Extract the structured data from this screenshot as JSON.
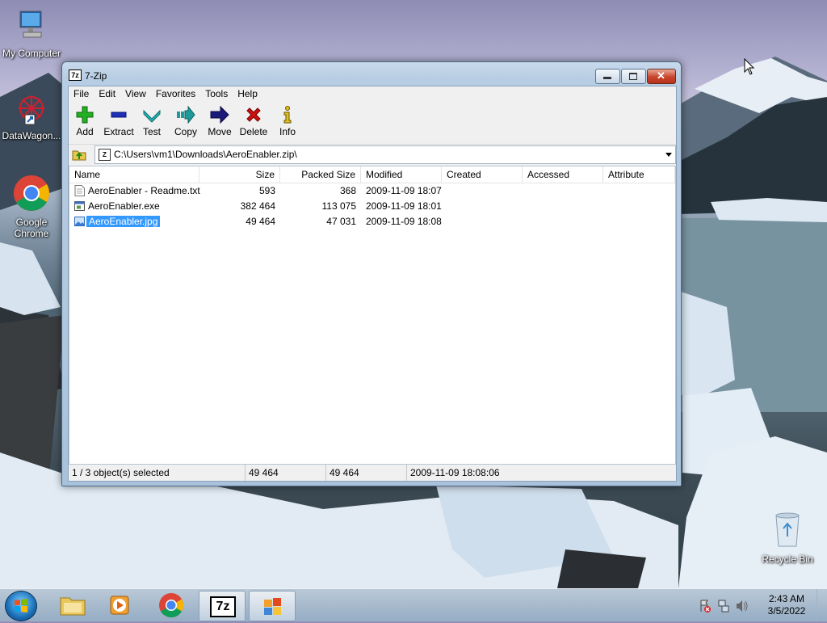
{
  "desktop": {
    "icons": [
      {
        "label": "My Computer"
      },
      {
        "label": "DataWagon..."
      },
      {
        "label_line1": "Google",
        "label_line2": "Chrome"
      },
      {
        "label": "Recycle Bin"
      }
    ]
  },
  "window": {
    "title": "7-Zip",
    "title_icon_text": "7z",
    "menu": [
      "File",
      "Edit",
      "View",
      "Favorites",
      "Tools",
      "Help"
    ],
    "toolbar": [
      {
        "label": "Add",
        "icon": "plus-icon",
        "color": "#22b022"
      },
      {
        "label": "Extract",
        "icon": "minus-icon",
        "color": "#1d2fb8"
      },
      {
        "label": "Test",
        "icon": "check-chevron-icon",
        "color": "#25b3b3"
      },
      {
        "label": "Copy",
        "icon": "copy-arrow-icon",
        "color": "#1f9a9a"
      },
      {
        "label": "Move",
        "icon": "move-arrow-icon",
        "color": "#1a1a7a"
      },
      {
        "label": "Delete",
        "icon": "x-icon",
        "color": "#cc1111"
      },
      {
        "label": "Info",
        "icon": "info-icon",
        "color": "#e0c020"
      }
    ],
    "address": "C:\\Users\\vm1\\Downloads\\AeroEnabler.zip\\",
    "columns": [
      "Name",
      "Size",
      "Packed Size",
      "Modified",
      "Created",
      "Accessed",
      "Attribute"
    ],
    "files": [
      {
        "name": "AeroEnabler - Readme.txt",
        "size": "593",
        "packed": "368",
        "modified": "2009-11-09 18:07",
        "icon": "text-file-icon",
        "selected": false
      },
      {
        "name": "AeroEnabler.exe",
        "size": "382 464",
        "packed": "113 075",
        "modified": "2009-11-09 18:01",
        "icon": "exe-file-icon",
        "selected": false
      },
      {
        "name": "AeroEnabler.jpg",
        "size": "49 464",
        "packed": "47 031",
        "modified": "2009-11-09 18:08",
        "icon": "image-file-icon",
        "selected": true
      }
    ],
    "status": {
      "selection": "1 / 3 object(s) selected",
      "size": "49 464",
      "packed": "49 464",
      "modified": "2009-11-09 18:08:06"
    }
  },
  "taskbar": {
    "clock_time": "2:43 AM",
    "clock_date": "3/5/2022",
    "seven_zip_label": "7z"
  }
}
